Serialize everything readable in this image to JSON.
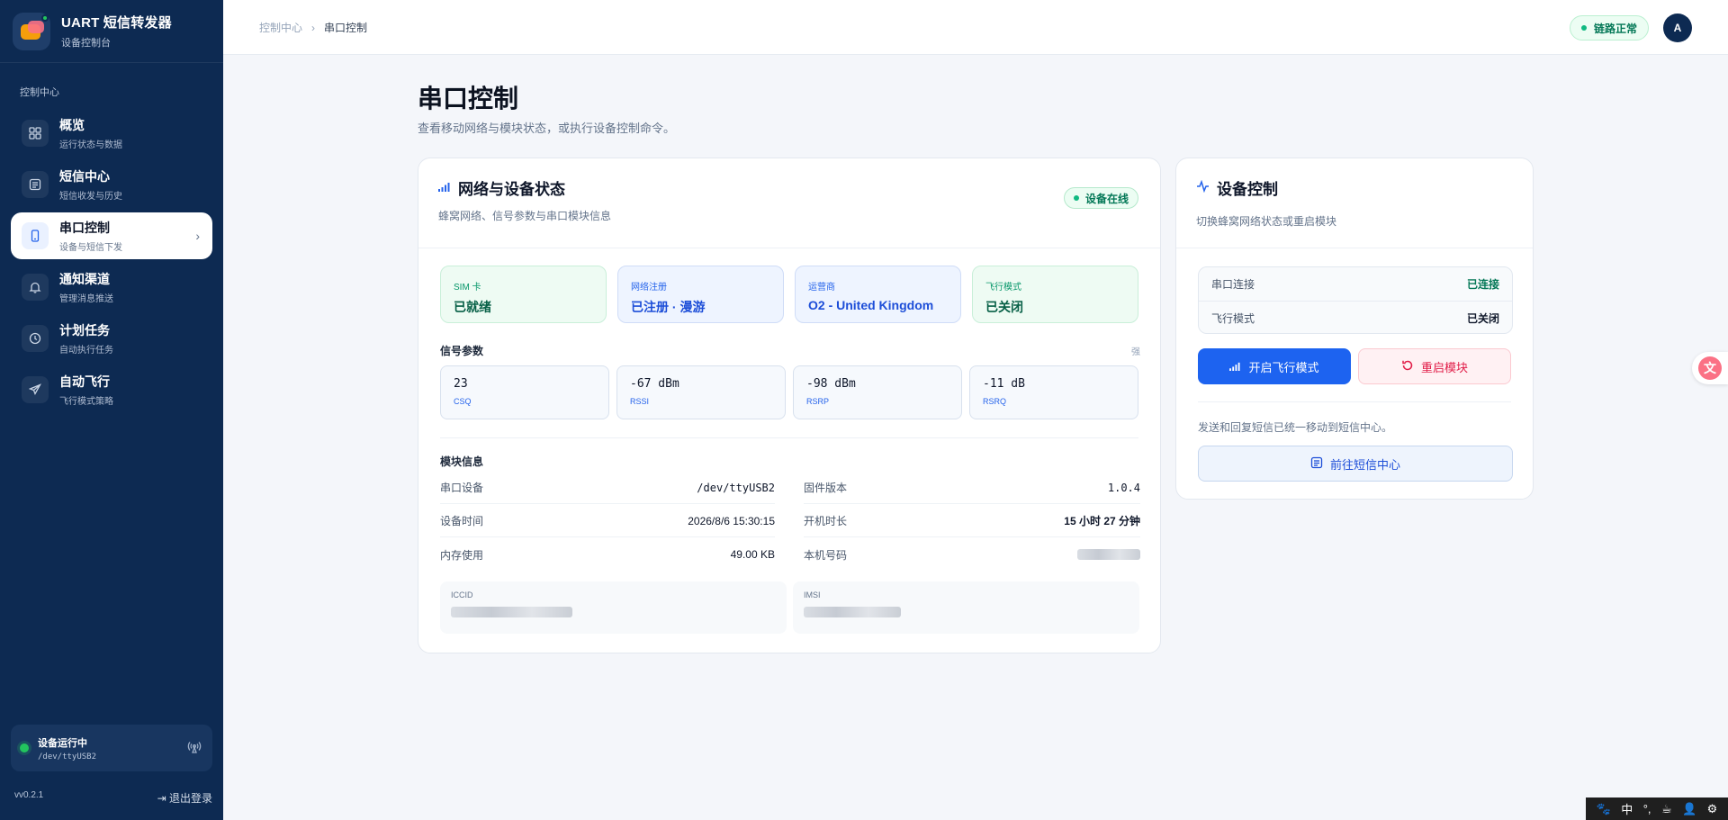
{
  "brand": {
    "title": "UART 短信转发器",
    "subtitle": "设备控制台"
  },
  "sidebar": {
    "section_label": "控制中心",
    "items": [
      {
        "title": "概览",
        "sub": "运行状态与数据",
        "icon": "grid-icon"
      },
      {
        "title": "短信中心",
        "sub": "短信收发与历史",
        "icon": "message-icon"
      },
      {
        "title": "串口控制",
        "sub": "设备与短信下发",
        "icon": "phone-icon",
        "active": true
      },
      {
        "title": "通知渠道",
        "sub": "管理消息推送",
        "icon": "bell-icon"
      },
      {
        "title": "计划任务",
        "sub": "自动执行任务",
        "icon": "clock-icon"
      },
      {
        "title": "自动飞行",
        "sub": "飞行模式策略",
        "icon": "plane-icon"
      }
    ],
    "status": {
      "title": "设备运行中",
      "device": "/dev/ttyUSB2"
    },
    "version": "vv0.2.1",
    "logout": "退出登录"
  },
  "topbar": {
    "breadcrumb": [
      "控制中心",
      "串口控制"
    ],
    "link_status": "链路正常",
    "avatar": "A"
  },
  "page": {
    "title": "串口控制",
    "subtitle": "查看移动网络与模块状态，或执行设备控制命令。"
  },
  "network": {
    "title": "网络与设备状态",
    "subtitle": "蜂窝网络、信号参数与串口模块信息",
    "badge": "设备在线",
    "tiles": [
      {
        "label": "SIM 卡",
        "value": "已就绪",
        "tone": "green"
      },
      {
        "label": "网络注册",
        "value": "已注册 · 漫游",
        "tone": "blue"
      },
      {
        "label": "运营商",
        "value": "O2 - United Kingdom",
        "tone": "blue"
      },
      {
        "label": "飞行模式",
        "value": "已关闭",
        "tone": "green"
      }
    ],
    "signal_title": "信号参数",
    "signal_hint": "强",
    "signals": [
      {
        "value": "23",
        "label": "CSQ"
      },
      {
        "value": "-67 dBm",
        "label": "RSSI"
      },
      {
        "value": "-98 dBm",
        "label": "RSRP"
      },
      {
        "value": "-11 dB",
        "label": "RSRQ"
      }
    ],
    "module_title": "模块信息",
    "module_left": [
      {
        "key": "串口设备",
        "value": "/dev/ttyUSB2"
      },
      {
        "key": "设备时间",
        "value": "2026/8/6 15:30:15"
      },
      {
        "key": "内存使用",
        "value": "49.00 KB"
      }
    ],
    "module_right": [
      {
        "key": "固件版本",
        "value": "1.0.4"
      },
      {
        "key": "开机时长",
        "value": "15 小时 27 分钟"
      },
      {
        "key": "本机号码",
        "value": ""
      }
    ],
    "iccid_label": "ICCID",
    "imsi_label": "IMSI"
  },
  "control": {
    "title": "设备控制",
    "subtitle": "切换蜂窝网络状态或重启模块",
    "serial_label": "串口连接",
    "serial_value": "已连接",
    "airplane_label": "飞行模式",
    "airplane_value": "已关闭",
    "btn_airplane": "开启飞行模式",
    "btn_restart": "重启模块",
    "note": "发送和回复短信已统一移动到短信中心。",
    "btn_sms": "前往短信中心"
  },
  "ime": {
    "chars": [
      "中",
      "°,",
      "☕",
      "👤",
      "⚙"
    ]
  },
  "colors": {
    "sidebar": "#0d2a52",
    "accent": "#1d63f0",
    "success": "#047857",
    "danger": "#e11d48"
  }
}
